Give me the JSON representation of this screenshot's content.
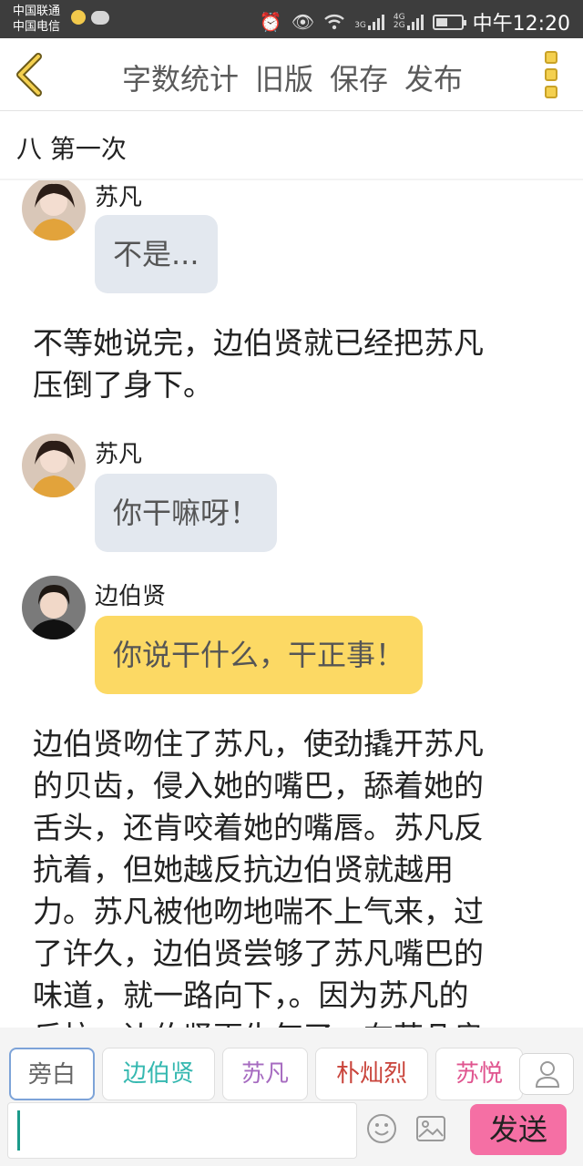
{
  "status_bar": {
    "carrier_1": "中国联通",
    "carrier_2": "中国电信",
    "network_1": "3G",
    "network_2a": "4G",
    "network_2b": "2G",
    "time": "中午12:20"
  },
  "toolbar": {
    "word_count": "字数统计",
    "old_version": "旧版",
    "save": "保存",
    "publish": "发布"
  },
  "chapter": {
    "title": "八 第一次"
  },
  "messages": [
    {
      "sender": "苏凡",
      "text": "不是...",
      "style": "gray"
    },
    {
      "narration": [
        "不等她说完，边伯贤就已经把苏凡",
        "压倒了身下。"
      ]
    },
    {
      "sender": "苏凡",
      "text": "你干嘛呀！",
      "style": "gray"
    },
    {
      "sender": "边伯贤",
      "text": "你说干什么，干正事！",
      "style": "yellow"
    },
    {
      "narration": [
        "边伯贤吻住了苏凡，使劲撬开苏凡",
        "的贝齿，侵入她的嘴巴，舔着她的",
        "舌头，还肯咬着她的嘴唇。苏凡反",
        "抗着，但她越反抗边伯贤就越用",
        "力。苏凡被他吻地喘不上气来，过",
        "了许久，边伯贤尝够了苏凡嘴巴的",
        "味道，就一路向下，。因为苏凡的",
        "反抗，边伯贤更生气了，在苏凡肩"
      ]
    }
  ],
  "roles": [
    {
      "label": "旁白",
      "color": "#666666"
    },
    {
      "label": "边伯贤",
      "color": "#35b8b0"
    },
    {
      "label": "苏凡",
      "color": "#a66bc0"
    },
    {
      "label": "朴灿烈",
      "color": "#c9443b"
    },
    {
      "label": "苏悦",
      "color": "#e0558f"
    }
  ],
  "input": {
    "send": "发送"
  },
  "colors": {
    "accent": "#f4d04f",
    "send_button": "#f56fa4",
    "bubble_gray": "#e3e8ef",
    "bubble_yellow": "#fcd964"
  }
}
